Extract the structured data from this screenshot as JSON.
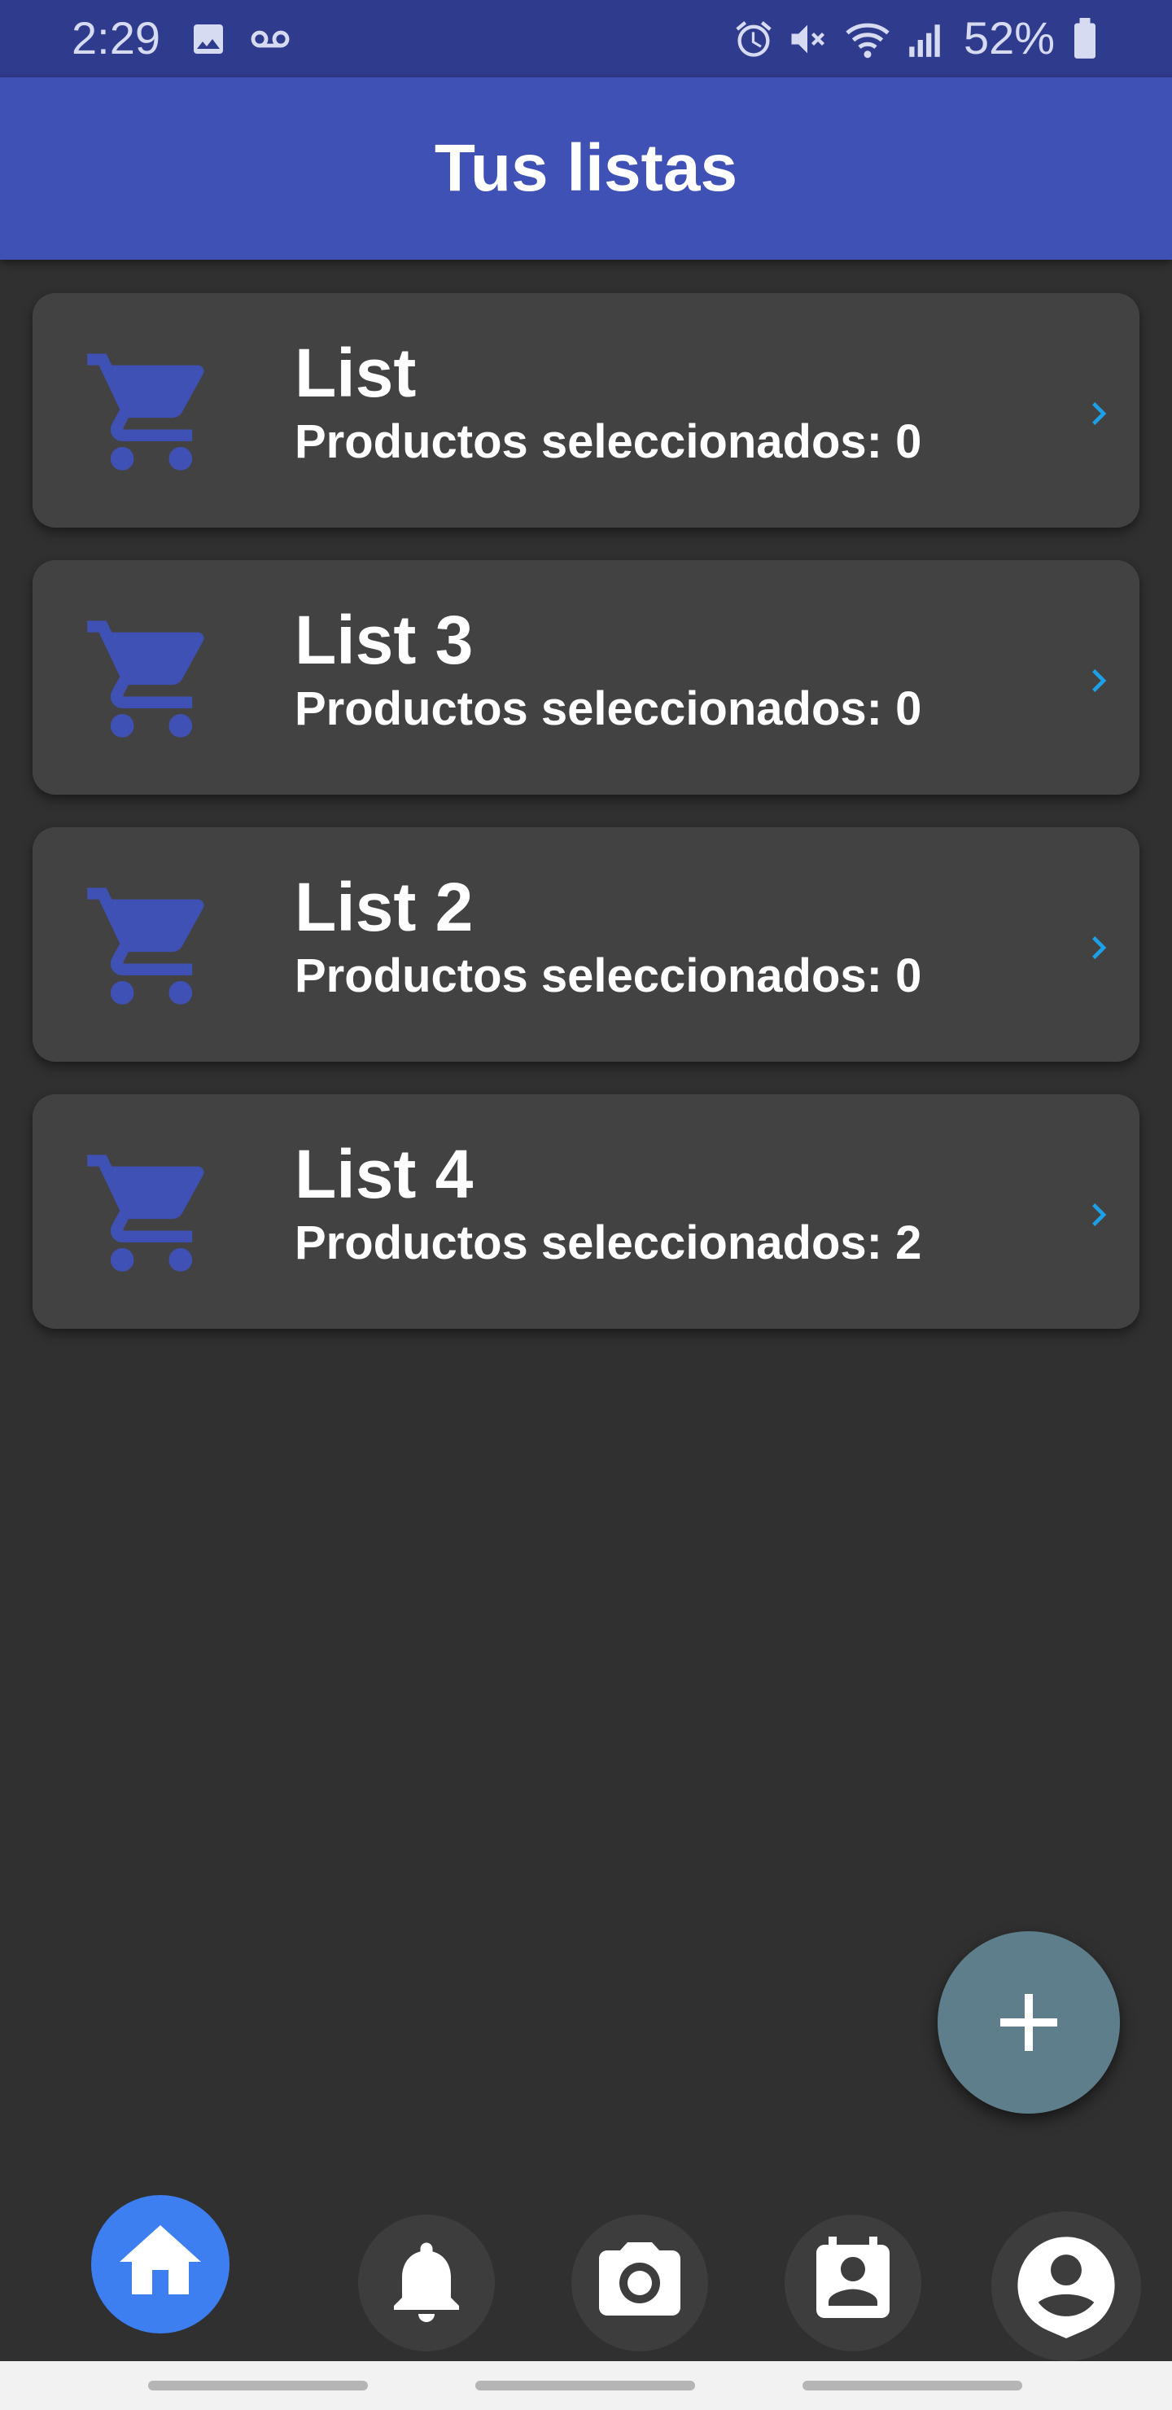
{
  "status_bar": {
    "time": "2:29",
    "battery": "52%",
    "icons": [
      "gallery-icon",
      "voicemail-icon",
      "alarm-icon",
      "mute-icon",
      "wifi-icon",
      "signal-icon",
      "battery-icon"
    ]
  },
  "app_bar": {
    "title": "Tus listas"
  },
  "lists": [
    {
      "title": "List",
      "subtitle": "Productos seleccionados: 0"
    },
    {
      "title": "List 3",
      "subtitle": "Productos seleccionados: 0"
    },
    {
      "title": "List 2",
      "subtitle": "Productos seleccionados: 0"
    },
    {
      "title": "List 4",
      "subtitle": "Productos seleccionados: 2"
    }
  ],
  "fab": {
    "icon": "plus-icon"
  },
  "bottom_nav": {
    "active": "home",
    "items": [
      "home-icon",
      "bell-icon",
      "camera-icon",
      "contacts-icon",
      "profile-icon"
    ]
  },
  "colors": {
    "status_bar": "#2f3b8c",
    "app_bar": "#3f51b5",
    "background": "#303030",
    "card": "#424242",
    "cart_icon": "#3f51b5",
    "chevron": "#1ea0e8",
    "fab": "#5f7e8c",
    "nav_active": "#3d7ff0",
    "nav_inactive": "#3d3d3d"
  }
}
